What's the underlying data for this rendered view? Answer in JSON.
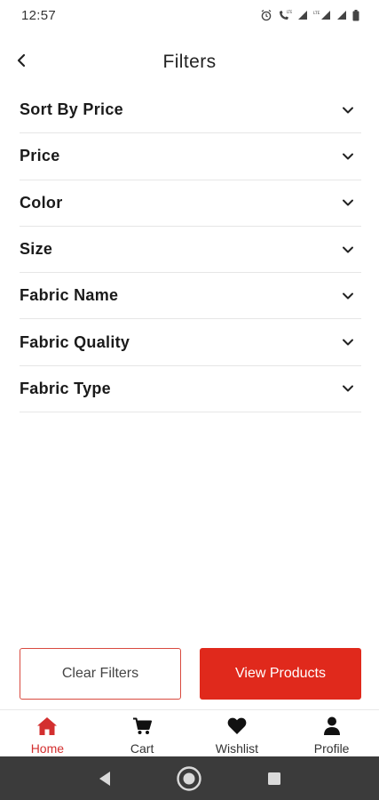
{
  "status_bar": {
    "time": "12:57"
  },
  "header": {
    "title": "Filters",
    "back_icon": "chevron-left-icon"
  },
  "filters": [
    {
      "label": "Sort By Price"
    },
    {
      "label": "Price"
    },
    {
      "label": "Color"
    },
    {
      "label": "Size"
    },
    {
      "label": "Fabric Name"
    },
    {
      "label": "Fabric Quality"
    },
    {
      "label": "Fabric Type"
    }
  ],
  "actions": {
    "clear_label": "Clear Filters",
    "view_label": "View Products"
  },
  "bottom_nav": [
    {
      "label": "Home",
      "icon": "home-icon",
      "active": true
    },
    {
      "label": "Cart",
      "icon": "cart-icon",
      "active": false
    },
    {
      "label": "Wishlist",
      "icon": "heart-icon",
      "active": false
    },
    {
      "label": "Profile",
      "icon": "person-icon",
      "active": false
    }
  ],
  "colors": {
    "accent": "#e0291c",
    "active_nav": "#d32f2f",
    "system_bar": "#3b3b3b"
  }
}
